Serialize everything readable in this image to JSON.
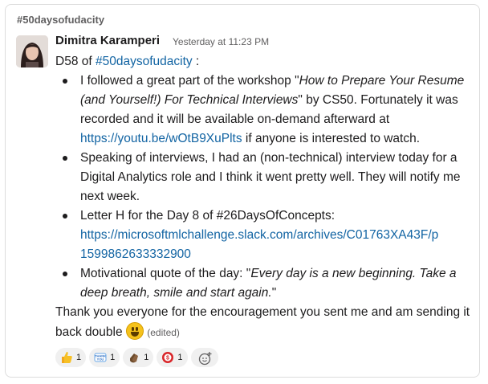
{
  "channel": "#50daysofudacity",
  "message": {
    "author": "Dimitra Karamperi",
    "timestamp": "Yesterday at 11:23 PM",
    "intro_prefix": "D58 of ",
    "intro_link": "#50daysofudacity",
    "intro_suffix": " :",
    "bullet1": {
      "text_a": "I followed a great part of the workshop \"",
      "italic": "How to Prepare Your Resume (and Yourself!) For Technical Interviews",
      "text_b": "\" by CS50. Fortunately it was recorded and it will be available on-demand afterward at ",
      "link": "https://youtu.be/wOtB9XuPlts",
      "text_c": " if anyone is interested to watch."
    },
    "bullet2": {
      "text": "Speaking of interviews, I had an (non-technical) interview today for a Digital Analytics role and I think it went pretty well. They will notify me next week."
    },
    "bullet3": {
      "text": "Letter H for the Day 8 of #26DaysOfConcepts:",
      "link_line1": "https://microsoftmlchallenge.slack.com/archives/C01763XA43F/p",
      "link_line2": "1599862633332900"
    },
    "bullet4": {
      "text": "Motivational quote of the day: \"",
      "italic": "Every day is a new beginning. Take a deep breath, smile and start again.",
      "text_end": "\""
    },
    "closing": "Thank you everyone for the encouragement you sent me and am sending it back double ",
    "edited": "(edited)"
  },
  "reactions": [
    {
      "icon": "thumbs-up-icon",
      "count": "1"
    },
    {
      "icon": "thank-you-icon",
      "count": "1"
    },
    {
      "icon": "clapping-hands-icon",
      "count": "1"
    },
    {
      "icon": "money-icon",
      "count": "1"
    }
  ],
  "colors": {
    "link": "#1264a3",
    "text": "#1d1c1d",
    "muted": "#616061"
  }
}
